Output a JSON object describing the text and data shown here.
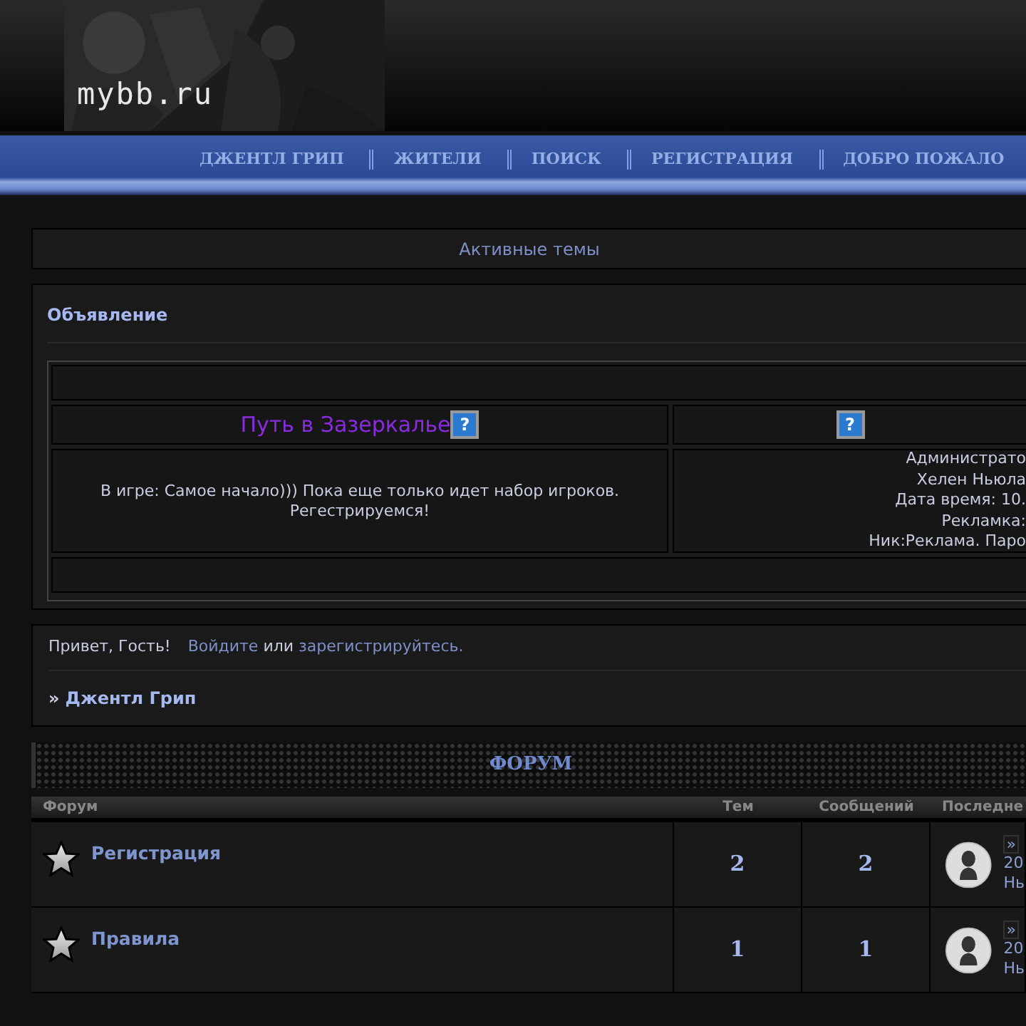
{
  "header": {
    "logo": "mybb.ru"
  },
  "nav": [
    {
      "label": "ДЖЕНТЛ ГРИП"
    },
    {
      "label": "ЖИТЕЛИ"
    },
    {
      "label": "ПОИСК"
    },
    {
      "label": "РЕГИСТРАЦИЯ"
    },
    {
      "label": "ДОБРО ПОЖАЛО"
    }
  ],
  "active_topics": "Активные темы",
  "announcement": {
    "title": "Объявление",
    "blocks": [
      {
        "title": "Путь в Зазеркалье",
        "help": "?",
        "lines": [
          "В игре: Самое начало))) Пока еще только идет набор игроков.",
          "Регестрируемся!"
        ]
      },
      {
        "help": "?",
        "lines": [
          "Администрато",
          "Хелен Ньюла",
          "Дата время: 10.",
          "Рекламка:",
          "Ник:Реклама. Паро"
        ]
      }
    ]
  },
  "welcome": {
    "greeting": "Привет, Гость!",
    "parts": [
      {
        "kind": "link",
        "text": "Войдите"
      },
      {
        "kind": "text",
        "text": " или "
      },
      {
        "kind": "link",
        "text": "зарегистрируйтесь."
      }
    ]
  },
  "breadcrumb": {
    "separator": "»",
    "label": "Джентл Грип"
  },
  "forum": {
    "title": "ФОРУМ",
    "columns": [
      "Форум",
      "Тем",
      "Сообщений",
      "Последне"
    ],
    "rows": [
      {
        "name": "Регистрация",
        "topics": "2",
        "posts": "2",
        "last_post": {
          "link": "»",
          "date": "20",
          "author": "Нь"
        }
      },
      {
        "name": "Правила",
        "topics": "1",
        "posts": "1",
        "last_post": {
          "link": "»",
          "date": "20",
          "author": "Нь"
        }
      }
    ]
  }
}
